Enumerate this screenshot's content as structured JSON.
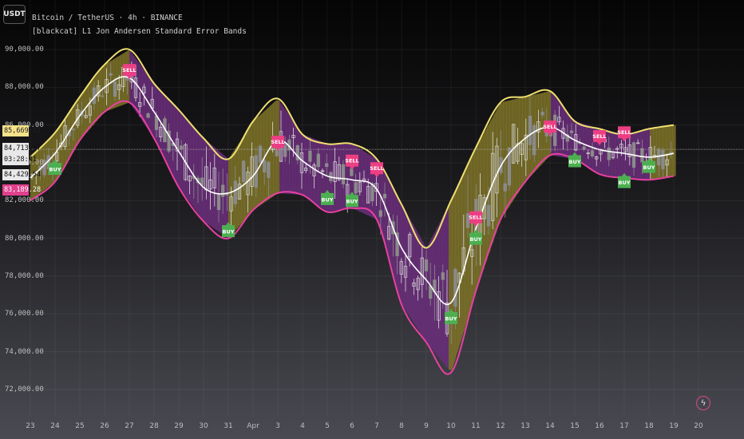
{
  "toolbar": {
    "currency_label": "USDT"
  },
  "legend": {
    "symbol_line": "Bitcoin / TetherUS · 4h · BINANCE",
    "indicator_line": "[blackcat] L1 Jon Andersen Standard Error Bands"
  },
  "price_tags": {
    "upper_band": "85,669.81",
    "last_price": "84,713.37",
    "countdown": "03:28:41",
    "middle_band": "84,429.54",
    "lower_band": "83,189.28"
  },
  "colors": {
    "bullish_fill": "#7d7228",
    "bearish_fill": "#6a2e7a",
    "upper_band": "#f0e070",
    "lower_band": "#e840a0",
    "middle_line": "#ffffff",
    "buy_signal": "#4caf50",
    "sell_signal": "#ec3f83"
  },
  "logo_icon": "lightning-icon",
  "chart_data": {
    "type": "line",
    "y_axis_ticks": [
      "90,000.00",
      "88,000.00",
      "86,000.00",
      "84,000.00",
      "82,000.00",
      "80,000.00",
      "78,000.00",
      "76,000.00",
      "74,000.00",
      "72,000.00"
    ],
    "x_axis_ticks": [
      "23",
      "24",
      "25",
      "26",
      "27",
      "28",
      "29",
      "30",
      "31",
      "Apr",
      "3",
      "4",
      "5",
      "6",
      "7",
      "8",
      "9",
      "10",
      "11",
      "12",
      "13",
      "14",
      "15",
      "16",
      "17",
      "18",
      "19",
      "20"
    ],
    "ylim": [
      71500,
      91200
    ],
    "x": [
      "23",
      "24",
      "25",
      "26",
      "27",
      "28",
      "29",
      "30",
      "31",
      "Apr",
      "3",
      "4",
      "5",
      "6",
      "7",
      "8",
      "9",
      "10",
      "11",
      "12",
      "13",
      "14",
      "15",
      "16",
      "17",
      "18",
      "19"
    ],
    "series": [],
    "upper_band": [
      84300,
      85600,
      87500,
      89200,
      90000,
      88200,
      86800,
      85300,
      84200,
      86200,
      87400,
      85500,
      85000,
      85000,
      84200,
      81800,
      79500,
      82000,
      84800,
      87200,
      87500,
      87800,
      86200,
      85800,
      85500,
      85800,
      86000
    ],
    "middle_line": [
      83200,
      84500,
      86500,
      88000,
      88500,
      86700,
      84600,
      82700,
      82400,
      83300,
      85200,
      84100,
      83300,
      83100,
      82600,
      79500,
      77800,
      76600,
      80500,
      83800,
      85300,
      85900,
      85200,
      84700,
      84500,
      84300,
      84500
    ],
    "lower_band": [
      82000,
      83000,
      85200,
      86700,
      87200,
      85300,
      82700,
      80900,
      80000,
      81500,
      82400,
      82300,
      81400,
      81600,
      81000,
      76500,
      74500,
      72900,
      77200,
      81000,
      83000,
      84400,
      84200,
      83400,
      83200,
      83100,
      83300
    ],
    "buy_signals": [
      {
        "x": "24",
        "price": 84000
      },
      {
        "x": "31",
        "price": 80700
      },
      {
        "x": "5",
        "price": 82400
      },
      {
        "x": "6",
        "price": 82300
      },
      {
        "x": "10",
        "price": 76100
      },
      {
        "x": "11",
        "price": 80300
      },
      {
        "x": "15",
        "price": 84400
      },
      {
        "x": "17",
        "price": 83300
      },
      {
        "x": "18",
        "price": 84100
      }
    ],
    "sell_signals": [
      {
        "x": "27",
        "price": 88600
      },
      {
        "x": "3",
        "price": 84800
      },
      {
        "x": "6",
        "price": 83800
      },
      {
        "x": "7",
        "price": 83400
      },
      {
        "x": "11",
        "price": 80800
      },
      {
        "x": "14",
        "price": 85600
      },
      {
        "x": "16",
        "price": 85100
      },
      {
        "x": "17",
        "price": 85300
      }
    ],
    "signal_labels": {
      "buy": "BUY",
      "sell": "SELL"
    },
    "last_price_line": 84713.37
  }
}
